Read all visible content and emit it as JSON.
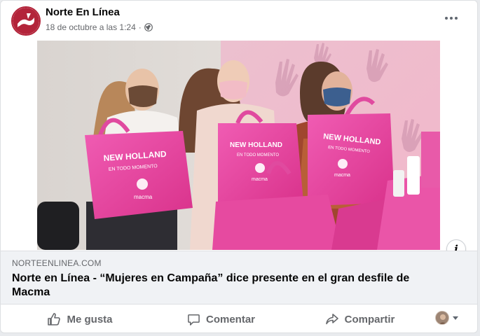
{
  "post": {
    "page_name": "Norte En Línea",
    "timestamp": "18 de octubre a las 1:24",
    "separator": "·",
    "audience_icon": "globe-icon",
    "more_icon": "more-options-icon"
  },
  "photo": {
    "bag_text_brand": "NEW HOLLAND",
    "bag_text_slogan": "EN TODO MOMENTO",
    "bag_text_logo": "macma",
    "info_label": "i"
  },
  "link": {
    "domain": "NORTEENLINEA.COM",
    "title": "Norte en Línea - “Mujeres en Campaña” dice presente en el gran desfile de Macma"
  },
  "actions": {
    "like": "Me gusta",
    "comment": "Comentar",
    "share": "Compartir"
  },
  "colors": {
    "accent_pink": "#e8469b",
    "text_secondary": "#65676b",
    "link_bg": "#f0f2f5",
    "logo_red": "#b3243a"
  }
}
